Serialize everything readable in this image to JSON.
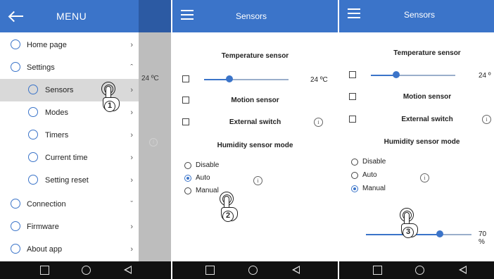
{
  "panel1": {
    "menu_title": "MENU",
    "items": [
      {
        "label": "Home page",
        "icon": "home-icon",
        "chevron": "›"
      },
      {
        "label": "Settings",
        "icon": "settings-icon",
        "chevron": "ˆ"
      },
      {
        "label": "Sensors",
        "icon": "sensors-icon",
        "chevron": "›"
      },
      {
        "label": "Modes",
        "icon": "modes-icon",
        "chevron": "›"
      },
      {
        "label": "Timers",
        "icon": "timers-icon",
        "chevron": "›"
      },
      {
        "label": "Current time",
        "icon": "clock-icon",
        "chevron": "›"
      },
      {
        "label": "Setting reset",
        "icon": "reset-icon",
        "chevron": "›"
      },
      {
        "label": "Connection",
        "icon": "connection-icon",
        "chevron": "ˇ"
      },
      {
        "label": "Firmware",
        "icon": "firmware-icon",
        "chevron": "›"
      },
      {
        "label": "About app",
        "icon": "info-icon",
        "chevron": "›"
      }
    ],
    "behind_temp": "24 ºC",
    "behind_info": "i",
    "tap_step": "1"
  },
  "panel2": {
    "title": "Sensors",
    "temperature_sensor": "Temperature sensor",
    "temperature_value": "24 ºC",
    "temperature_slider_fraction": 0.3,
    "motion_sensor": "Motion sensor",
    "external_switch": "External switch",
    "humidity_mode_title": "Humidity sensor mode",
    "options": [
      "Disable",
      "Auto",
      "Manual"
    ],
    "selected": "Auto",
    "info": "i",
    "tap_step": "2"
  },
  "panel3": {
    "title": "Sensors",
    "temperature_sensor": "Temperature sensor",
    "temperature_value": "24 º",
    "temperature_slider_fraction": 0.3,
    "motion_sensor": "Motion sensor",
    "external_switch": "External switch",
    "humidity_mode_title": "Humidity sensor mode",
    "options": [
      "Disable",
      "Auto",
      "Manual"
    ],
    "selected": "Manual",
    "info": "i",
    "humidity_value": "70 %",
    "humidity_slider_fraction": 0.7,
    "tap_step": "3"
  },
  "colors": {
    "accent": "#3b74c9",
    "navbar": "#111111",
    "selected_row": "#d9d9d9"
  }
}
